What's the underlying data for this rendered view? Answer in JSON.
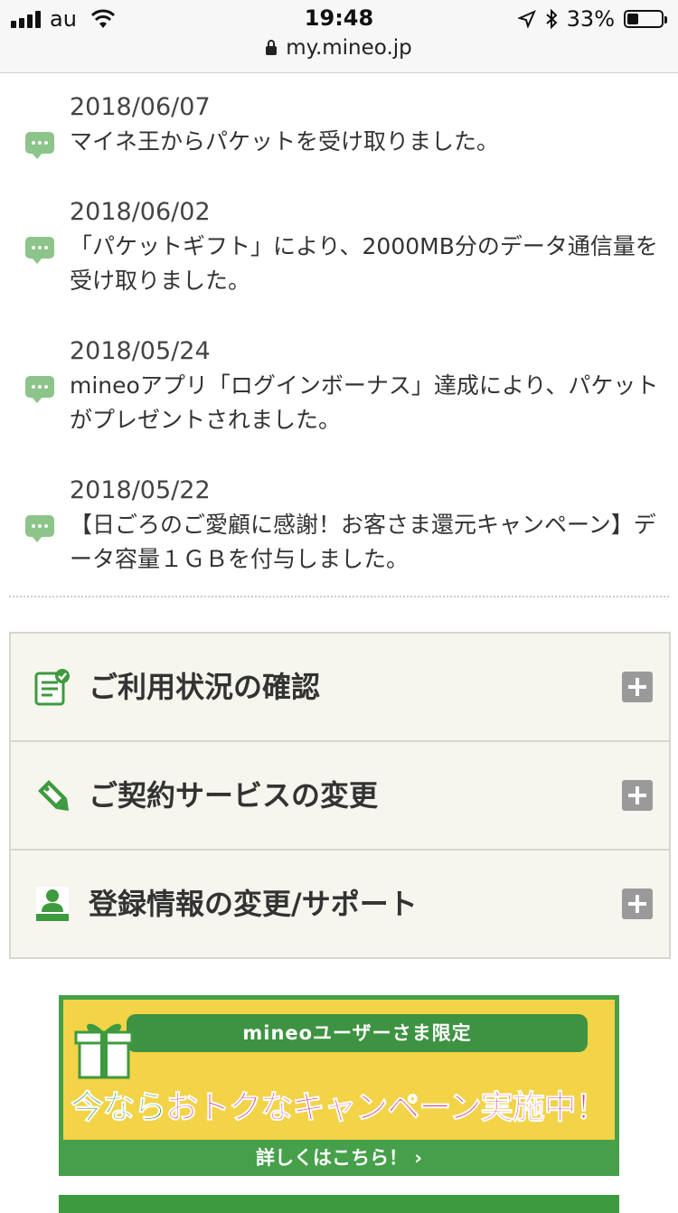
{
  "status_bar": {
    "carrier": "au",
    "time": "19:48",
    "battery": "33%",
    "battery_level": 0.33,
    "url": "my.mineo.jp"
  },
  "news": [
    {
      "date": "2018/06/07",
      "text": "マイネ王からパケットを受け取りました。"
    },
    {
      "date": "2018/06/02",
      "text": "「パケットギフト」により、2000MB分のデータ通信量を受け取りました。"
    },
    {
      "date": "2018/05/24",
      "text": "mineoアプリ「ログインボーナス」達成により、パケットがプレゼントされました。"
    },
    {
      "date": "2018/05/22",
      "text": "【日ごろのご愛顧に感謝！お客さま還元キャンペーン】データ容量１ＧＢを付与しました。"
    }
  ],
  "menu": [
    {
      "label": "ご利用状況の確認",
      "icon": "usage-checklist-icon"
    },
    {
      "label": "ご契約サービスの変更",
      "icon": "pencil-tag-icon"
    },
    {
      "label": "登録情報の変更/サポート",
      "icon": "person-desk-icon"
    }
  ],
  "banner": {
    "ribbon": "mineoユーザーさま限定",
    "headline_a": "今なら",
    "headline_b": "おトクなキャンペーン実施中！",
    "cta": "詳しくはこちら！ ›"
  },
  "colors": {
    "accent_green": "#46a04a",
    "bubble_green": "#8cc48a",
    "menu_bg": "#f7f6ee",
    "banner_yellow": "#f3d347",
    "banner_pink": "#d8407a"
  }
}
